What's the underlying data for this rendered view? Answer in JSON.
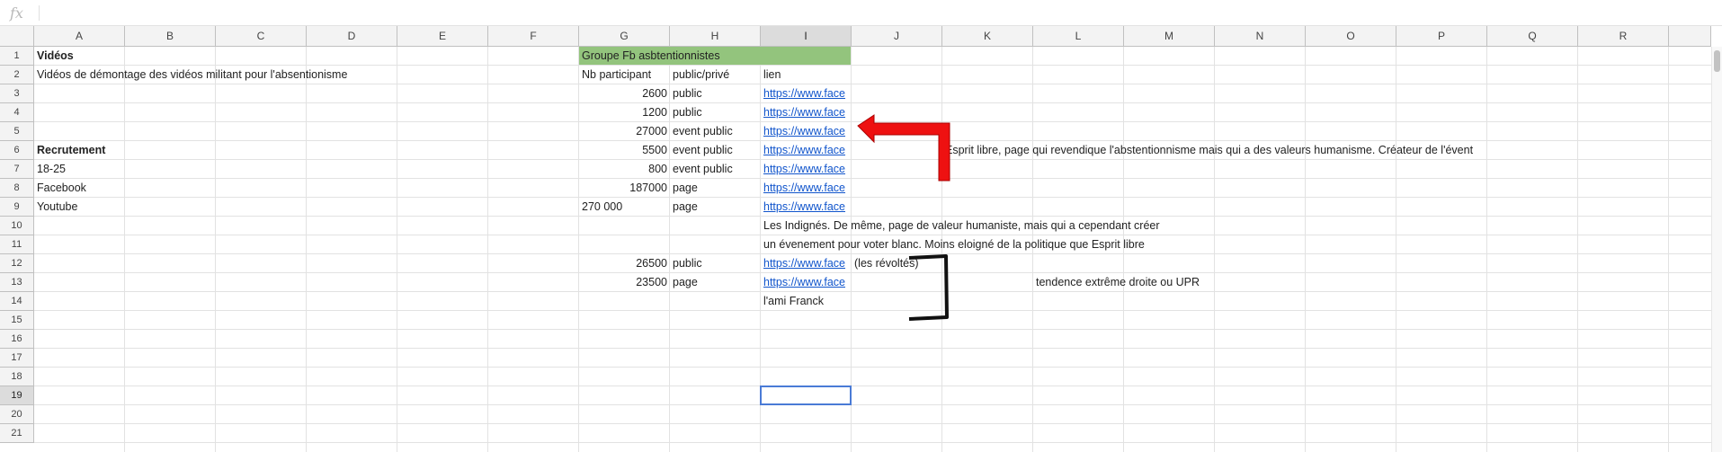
{
  "formula_bar": {
    "icon": "fx",
    "value": ""
  },
  "columns": [
    "A",
    "B",
    "C",
    "D",
    "E",
    "F",
    "G",
    "H",
    "I",
    "J",
    "K",
    "L",
    "M",
    "N",
    "O",
    "P",
    "Q",
    "R"
  ],
  "rows": [
    "1",
    "2",
    "3",
    "4",
    "5",
    "6",
    "7",
    "8",
    "9",
    "10",
    "11",
    "12",
    "13",
    "14",
    "15",
    "16",
    "17",
    "18",
    "19",
    "20",
    "21"
  ],
  "selected_cell": "I19",
  "header_fill_color": "#93c47d",
  "cells": {
    "A1": "Vidéos",
    "A2": "Vidéos de démontage des vidéos militant pour l'absentionisme",
    "A6": "Recrutement",
    "A7": "18-25",
    "A8": "Facebook",
    "A9": "Youtube",
    "G1": "Groupe Fb asbtentionnistes",
    "G2": "Nb participant",
    "H2": "public/privé",
    "I2": "lien",
    "G3": "2600",
    "H3": "public",
    "I3": "https://www.face",
    "G4": "1200",
    "H4": "public",
    "I4": "https://www.face",
    "G5": "27000",
    "H5": "event public",
    "I5": "https://www.face",
    "G6": "5500",
    "H6": "event public",
    "I6": "https://www.face",
    "K6": "Esprit libre, page qui revendique l'abstentionnisme mais qui a des valeurs humanisme. Créateur de l'évent",
    "G7": "800",
    "H7": "event public",
    "I7": "https://www.face",
    "G8": "187000",
    "H8": "page",
    "I8": "https://www.face",
    "G9": "270 000",
    "H9": "page",
    "I9": "https://www.face",
    "I10": "Les Indignés. De même, page de valeur humaniste, mais qui a cependant créer",
    "I11": "un évenement pour voter blanc. Moins eloigné de la politique que Esprit libre",
    "G12": "26500",
    "H12": "public",
    "I12": "https://www.face",
    "J12": "(les révoltés)",
    "G13": "23500",
    "H13": "page",
    "I13": "https://www.face",
    "L13": "tendence extrême droite ou UPR",
    "I14": "l'ami Franck"
  }
}
